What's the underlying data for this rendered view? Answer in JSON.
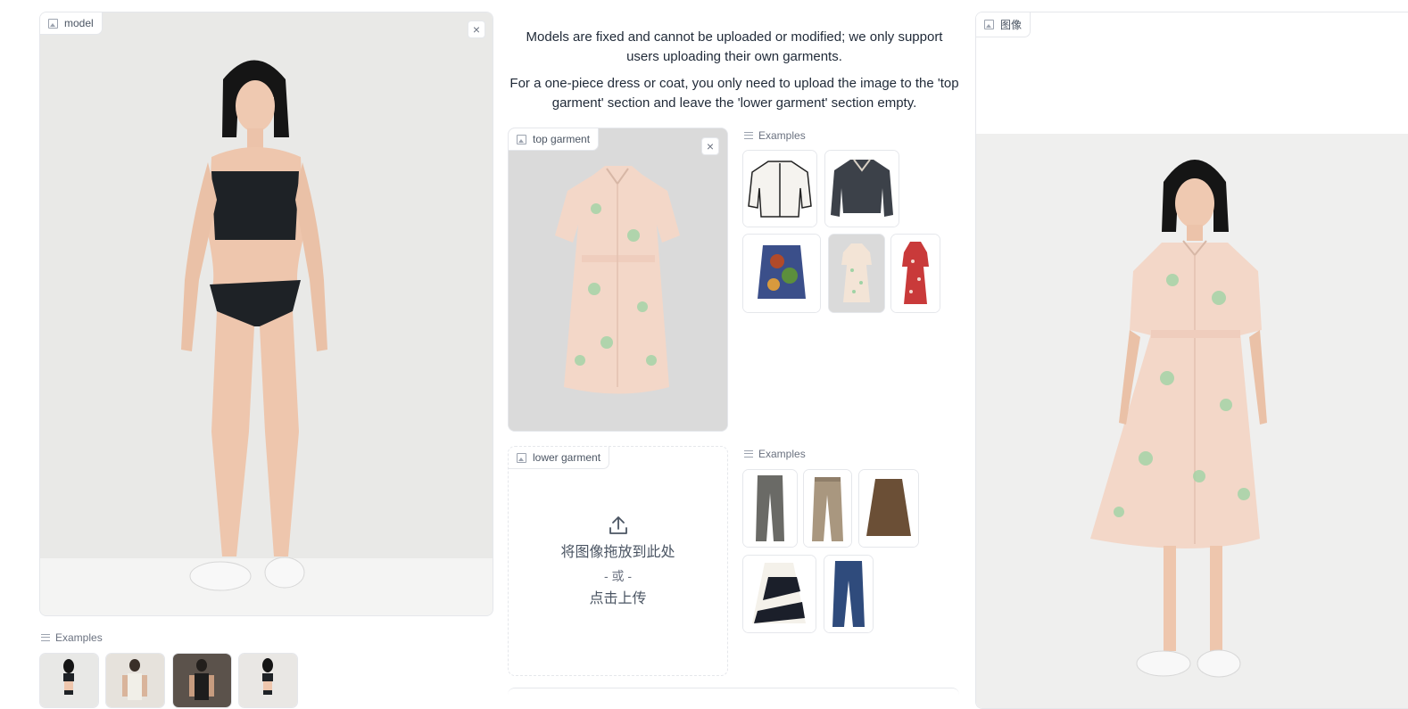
{
  "model_panel": {
    "label": "model",
    "close": "×"
  },
  "model_examples": {
    "label": "Examples",
    "count": 4
  },
  "info": {
    "line1": "Models are fixed and cannot be uploaded or modified; we only support users uploading their own garments.",
    "line2": "For a one-piece dress or coat, you only need to upload the image to the 'top garment' section and leave the 'lower garment' section empty."
  },
  "top_garment": {
    "label": "top garment",
    "close": "×"
  },
  "top_examples": {
    "label": "Examples"
  },
  "lower_garment": {
    "label": "lower garment",
    "drop_text": "将图像拖放到此处",
    "or_text": "- 或 -",
    "click_text": "点击上传"
  },
  "lower_examples": {
    "label": "Examples"
  },
  "result_panel": {
    "label": "图像"
  },
  "colors": {
    "border": "#e5e7eb",
    "dress_pink": "#f3d7c8",
    "dress_green": "#9fd3a5",
    "black_garment": "#1f2329"
  },
  "icons": [
    "image-icon",
    "close-icon",
    "list-icon",
    "upload-icon"
  ]
}
